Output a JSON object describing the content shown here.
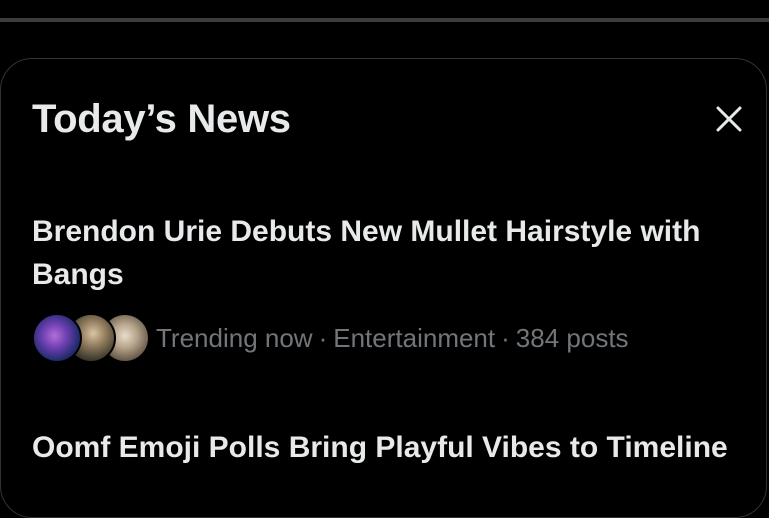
{
  "card": {
    "title": "Today’s News",
    "close_icon": "close-icon"
  },
  "news": [
    {
      "headline": "Brendon Urie Debuts New Mullet Hairstyle with Bangs",
      "status": "Trending now",
      "category": "Entertainment",
      "posts": "384 posts",
      "separator": "·"
    },
    {
      "headline": "Oomf Emoji Polls Bring Playful Vibes to Timeline"
    }
  ],
  "colors": {
    "background": "#000000",
    "text_primary": "#e7e9ea",
    "text_secondary": "#71767b",
    "border": "#2f3336"
  }
}
